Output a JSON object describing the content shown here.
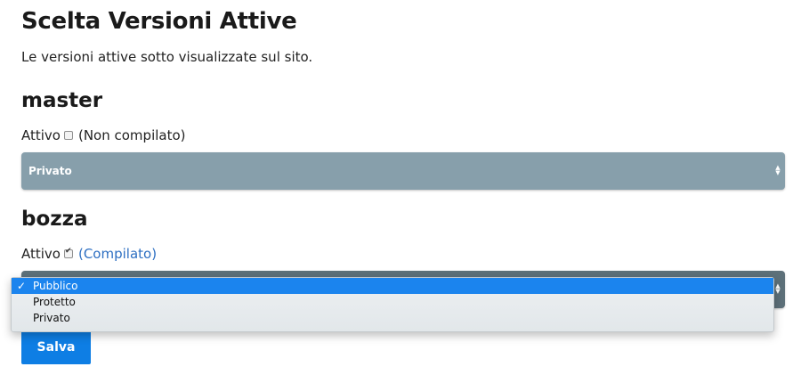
{
  "page": {
    "title": "Scelta Versioni Attive",
    "subtitle": "Le versioni attive sotto visualizzate sul sito."
  },
  "versions": [
    {
      "name": "master",
      "active_label": "Attivo",
      "active_checked": false,
      "compile_status": "(Non compilato)",
      "visibility": "Privato"
    },
    {
      "name": "bozza",
      "active_label": "Attivo",
      "active_checked": true,
      "compile_status": "(Compilato)",
      "visibility": "Pubblico"
    }
  ],
  "dropdown": {
    "check_icon": "✓",
    "options": [
      "Pubblico",
      "Protetto",
      "Privato"
    ],
    "selected": "Pubblico"
  },
  "save_button": {
    "label": "Salva"
  },
  "colors": {
    "accent": "#0e7ee4",
    "link": "#2d6fc2",
    "select_master_bg": "#879fab",
    "select_bozza_bg": "#5d7079",
    "dropdown_highlight": "#1b84ee"
  }
}
